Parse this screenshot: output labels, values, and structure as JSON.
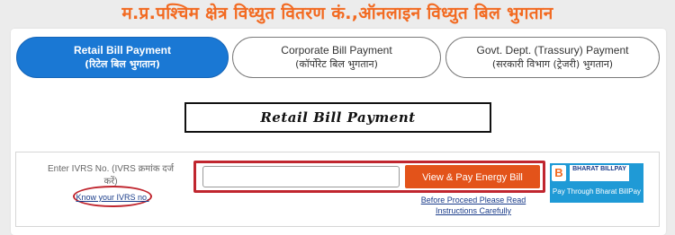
{
  "header": {
    "title": "म.प्र.पश्चिम क्षेत्र विध्युत वितरण कं.,ऑनलाइन विध्युत बिल भुगतान"
  },
  "tabs": [
    {
      "label": "Retail Bill Payment",
      "sublabel": "(रिटेल बिल भुगतान)",
      "active": true
    },
    {
      "label": "Corporate Bill Payment",
      "sublabel": "(कॉर्पोरेट बिल भुगतान)",
      "active": false
    },
    {
      "label": "Govt. Dept. (Trassury) Payment",
      "sublabel": "(सरकारी विभाग (ट्रेजरी) भुगतान)",
      "active": false
    }
  ],
  "section": {
    "title": "Retail Bill Payment"
  },
  "ivrs": {
    "label": "Enter IVRS No. (IVRS क्रमांक दर्ज करें)",
    "know_link": "Know your IVRS no.",
    "input_value": "",
    "input_placeholder": ""
  },
  "actions": {
    "pay_button": "View & Pay Energy Bill",
    "instructions_link": "Before Proceed Please Read Instructions Carefully"
  },
  "bbps": {
    "logo_letter": "B",
    "brand": "BHARAT BILLPAY",
    "label": "Pay Through Bharat BillPay"
  },
  "colors": {
    "header_orange": "#f26a21",
    "active_tab_blue": "#1a78d4",
    "pay_button_orange": "#e3531a",
    "highlight_red": "#c0262f",
    "bbps_blue": "#1f9ad6"
  }
}
